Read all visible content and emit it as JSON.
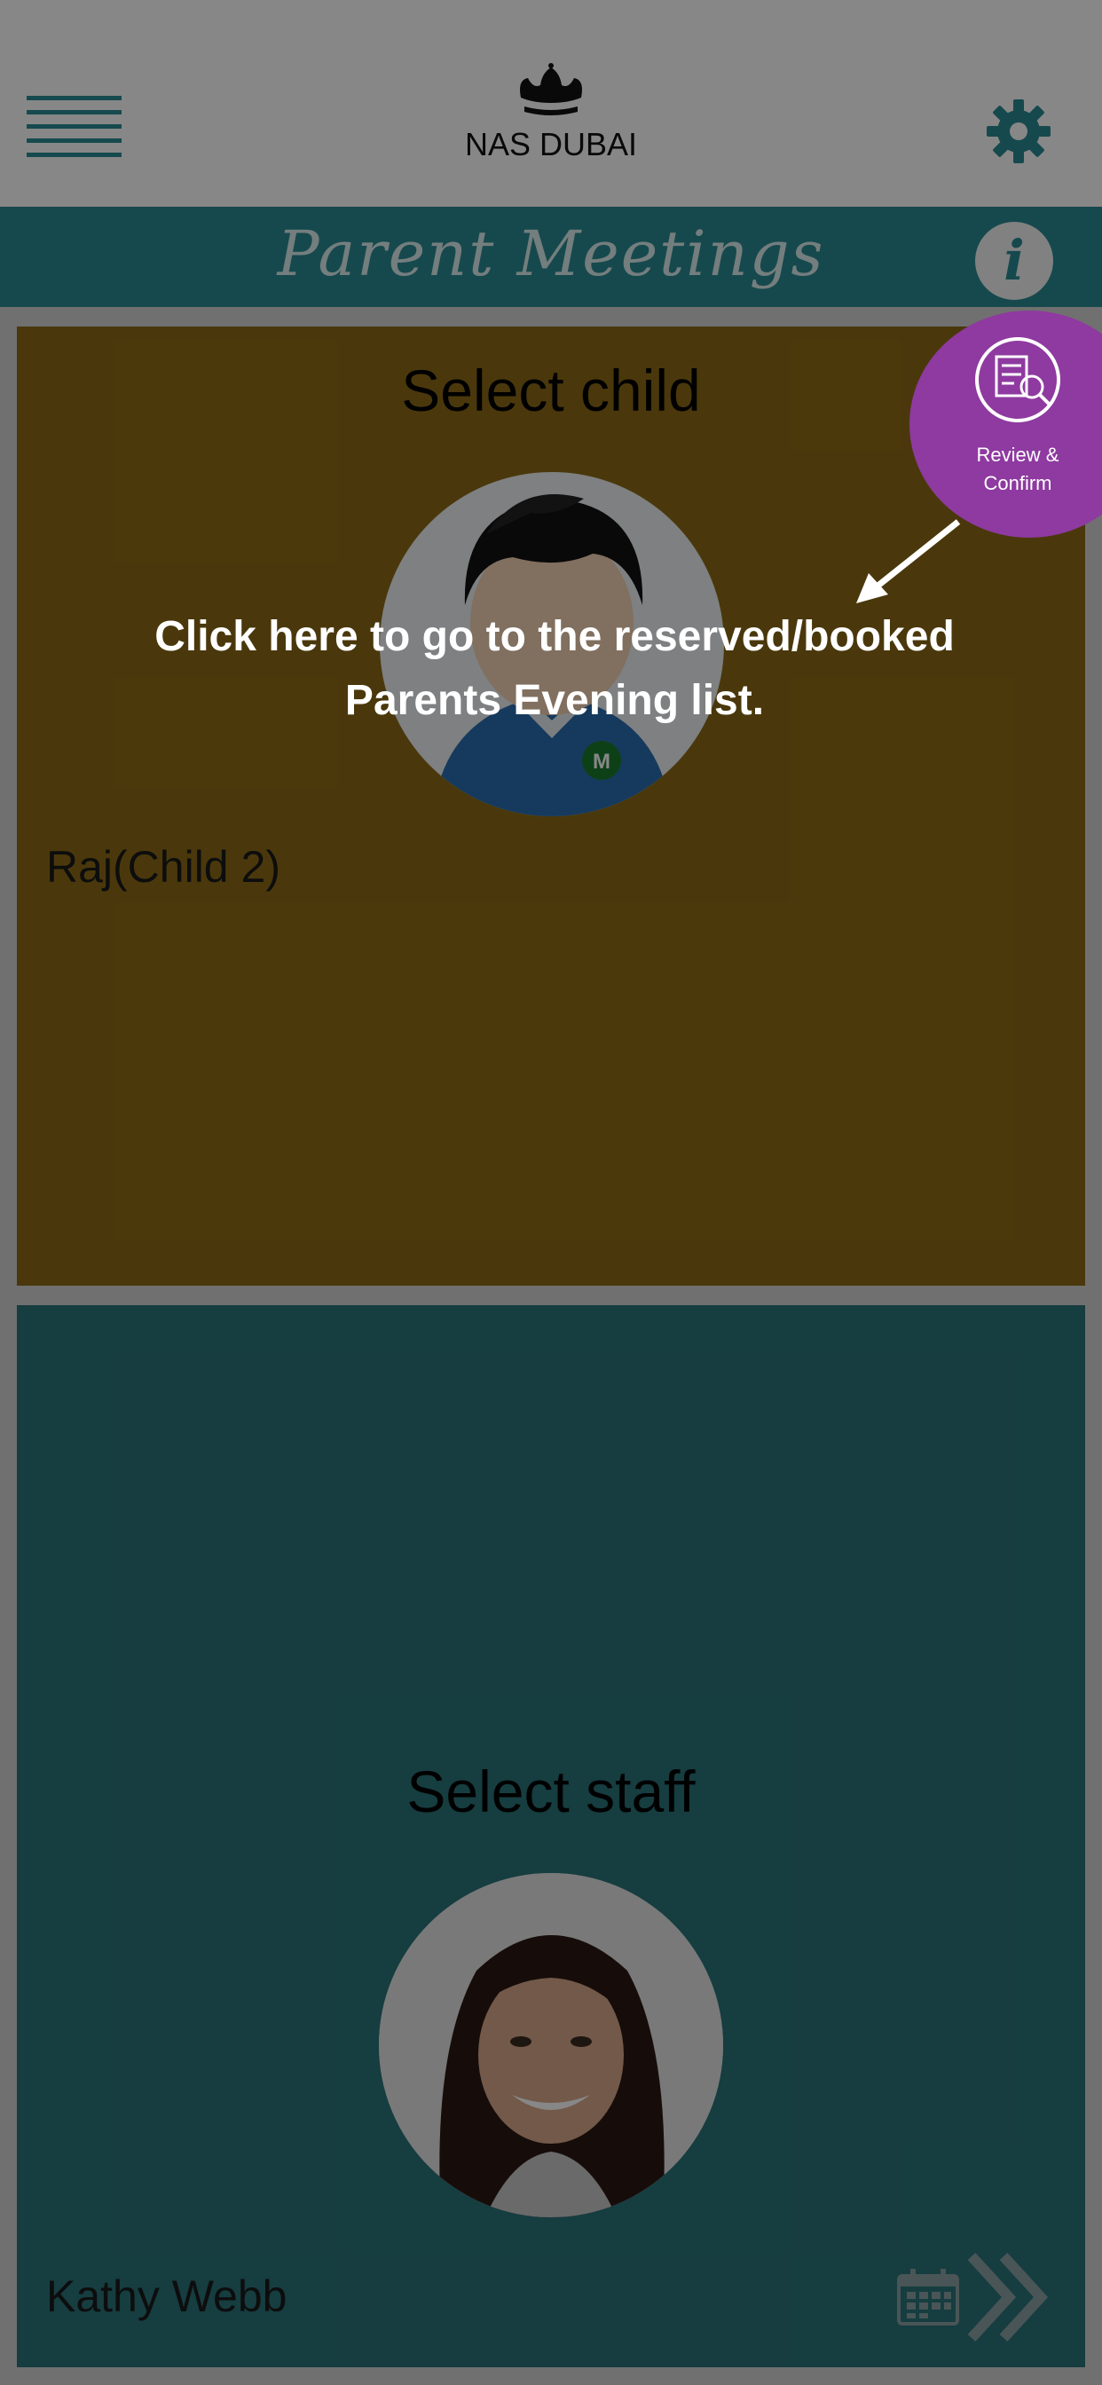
{
  "header": {
    "logo_text": "NAS DUBAI",
    "menu_icon": "hamburger-menu-icon",
    "settings_icon": "gear-icon"
  },
  "titlebar": {
    "title": "Parent Meetings",
    "info_label": "i"
  },
  "child_panel": {
    "heading": "Select child",
    "child_name": "Raj(Child 2)",
    "avatar_badge": "M"
  },
  "staff_panel": {
    "heading": "Select staff",
    "staff_name": "Kathy Webb"
  },
  "review_button": {
    "label_line1": "Review &",
    "label_line2": "Confirm"
  },
  "overlay_hint": {
    "line1": "Click here to go to the reserved/booked",
    "line2": "Parents Evening list."
  },
  "colors": {
    "teal": "#2b8a91",
    "child_panel_bg": "#8d6b17",
    "staff_panel_bg": "#2b737a",
    "review_purple": "#8e3aa0"
  }
}
